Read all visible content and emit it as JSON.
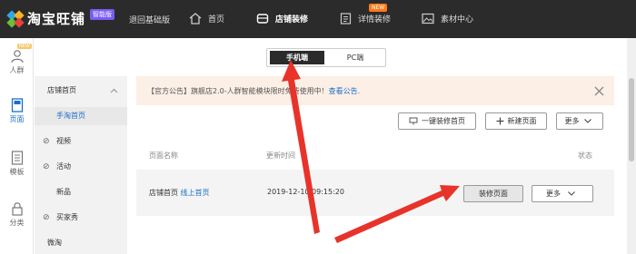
{
  "topbar": {
    "brand": "淘宝旺铺",
    "edition_badge": "智能版",
    "back_label": "退回基础版",
    "nav": [
      {
        "label": "首页",
        "icon": "home-icon"
      },
      {
        "label": "店铺装修",
        "icon": "store-icon",
        "active": true
      },
      {
        "label": "详情装修",
        "icon": "detail-icon",
        "badge": "NEW"
      },
      {
        "label": "素材中心",
        "icon": "image-icon"
      }
    ]
  },
  "rail": {
    "items": [
      {
        "label": "人群",
        "icon": "person-icon",
        "badge": "NEW"
      },
      {
        "label": "页面",
        "icon": "page-icon",
        "active": true
      },
      {
        "label": "模板",
        "icon": "template-icon"
      },
      {
        "label": "分类",
        "icon": "lock-icon"
      }
    ]
  },
  "sidebar": {
    "items": [
      {
        "label": "店铺首页"
      },
      {
        "label": "手淘首页",
        "active": true
      },
      {
        "label": "视频"
      },
      {
        "label": "活动"
      },
      {
        "label": "新品"
      },
      {
        "label": "买家秀"
      },
      {
        "label": "微淘"
      }
    ]
  },
  "toggle": {
    "mobile": "手机端",
    "pc": "PC端"
  },
  "notice": {
    "text": "【官方公告】旗舰店2.0-人群智能模块限时免费使用中！",
    "link": "查看公告."
  },
  "actions": {
    "one_click": "一键装修首页",
    "new_page": "新建页面",
    "more": "更多"
  },
  "table": {
    "columns": [
      "页面名称",
      "更新时间",
      "状态"
    ],
    "rows": [
      {
        "name": "店铺首页",
        "status_link": "线上首页",
        "updated": "2019-12-10 09:15:20",
        "edit": "装修页面",
        "more": "更多"
      }
    ]
  },
  "colors": {
    "topbar": "#2b2b2b",
    "accent": "#1a6fc9",
    "arrow": "#e8332a",
    "notice_bg": "#fcefe6",
    "badge_purple": "#7a5cf5",
    "badge_orange": "#ff7a1a"
  }
}
